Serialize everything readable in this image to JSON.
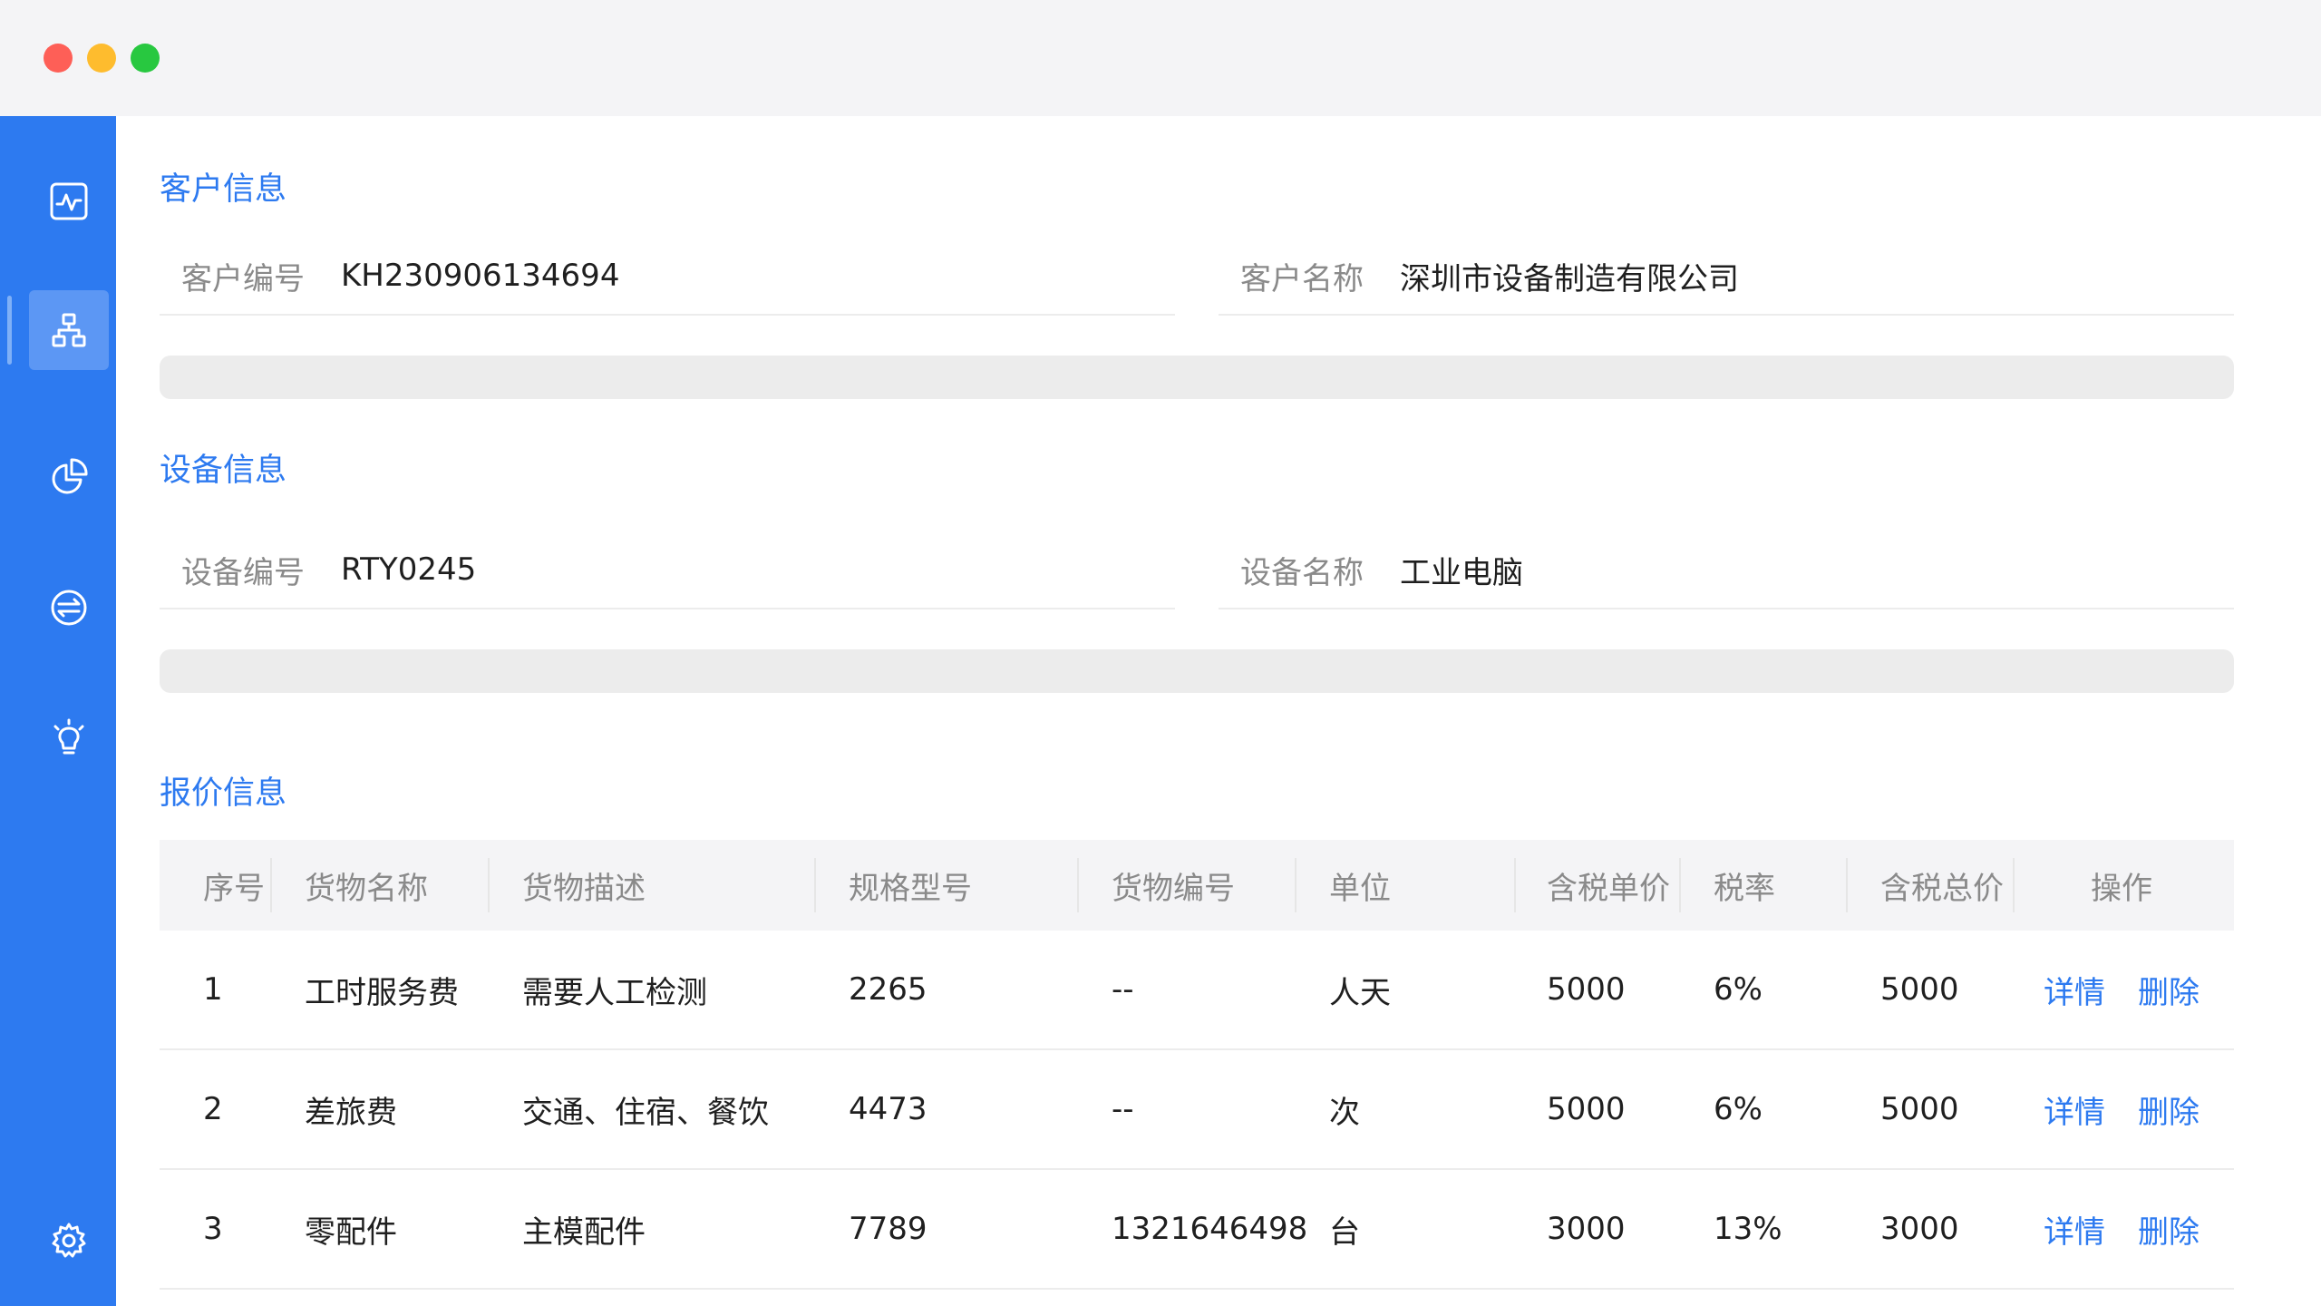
{
  "window": {
    "controls": [
      "close",
      "minimize",
      "maximize"
    ]
  },
  "sidebar": {
    "items": [
      {
        "icon": "activity-monitor-icon",
        "active": false
      },
      {
        "icon": "org-chart-icon",
        "active": true
      },
      {
        "icon": "pie-chart-icon",
        "active": false
      },
      {
        "icon": "exchange-icon",
        "active": false
      },
      {
        "icon": "lightbulb-icon",
        "active": false
      },
      {
        "icon": "gear-icon",
        "active": false
      }
    ],
    "accent_color": "#2d7af0"
  },
  "customer": {
    "title": "客户信息",
    "id_label": "客户编号",
    "id_value": "KH230906134694",
    "name_label": "客户名称",
    "name_value": "深圳市设备制造有限公司"
  },
  "device": {
    "title": "设备信息",
    "id_label": "设备编号",
    "id_value": "RTY0245",
    "name_label": "设备名称",
    "name_value": "工业电脑"
  },
  "quote": {
    "title": "报价信息",
    "columns": [
      "序号",
      "货物名称",
      "货物描述",
      "规格型号",
      "货物编号",
      "单位",
      "含税单价",
      "税率",
      "含税总价",
      "操作"
    ],
    "rows": [
      {
        "no": "1",
        "name": "工时服务费",
        "desc": "需要人工检测",
        "spec": "2265",
        "code": "--",
        "unit": "人天",
        "price": "5000",
        "tax": "6%",
        "total": "5000",
        "detail": "详情",
        "delete": "删除"
      },
      {
        "no": "2",
        "name": "差旅费",
        "desc": "交通、住宿、餐饮",
        "spec": "4473",
        "code": "--",
        "unit": "次",
        "price": "5000",
        "tax": "6%",
        "total": "5000",
        "detail": "详情",
        "delete": "删除"
      },
      {
        "no": "3",
        "name": "零配件",
        "desc": "主模配件",
        "spec": "7789",
        "code": "1321646498",
        "unit": "台",
        "price": "3000",
        "tax": "13%",
        "total": "3000",
        "detail": "详情",
        "delete": "删除"
      }
    ]
  }
}
